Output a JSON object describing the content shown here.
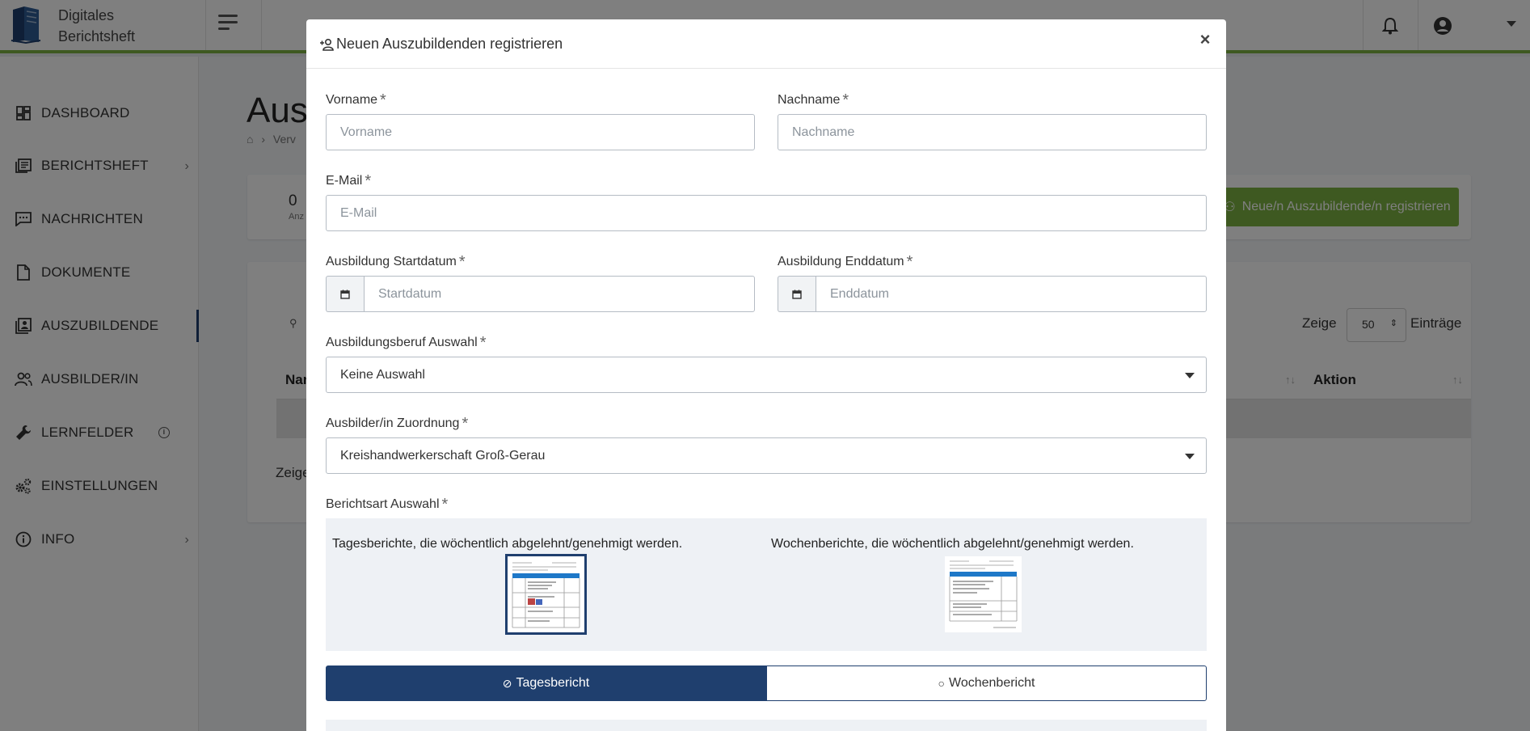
{
  "app": {
    "title_line1": "Digitales",
    "title_line2": "Berichtsheft"
  },
  "sidebar": {
    "items": [
      {
        "label": "DASHBOARD",
        "icon": "dashboard-icon"
      },
      {
        "label": "BERICHTSHEFT",
        "icon": "book-icon",
        "chevron": "›"
      },
      {
        "label": "NACHRICHTEN",
        "icon": "message-icon"
      },
      {
        "label": "DOKUMENTE",
        "icon": "document-icon"
      },
      {
        "label": "AUSZUBILDENDE",
        "icon": "trainees-icon",
        "active": true
      },
      {
        "label": "AUSBILDER/IN",
        "icon": "trainers-icon"
      },
      {
        "label": "LERNFELDER",
        "icon": "wrench-icon",
        "info": "i"
      },
      {
        "label": "EINSTELLUNGEN",
        "icon": "cogs-icon"
      },
      {
        "label": "INFO",
        "icon": "info-icon",
        "chevron": "›"
      }
    ]
  },
  "background": {
    "page_title": "Ausz",
    "breadcrumb": "Verv",
    "stat_value": "0",
    "stat_label": "Anz",
    "register_button": "Neue/n Auszubildende/n registrieren",
    "show_label": "Zeige",
    "show_value": "50",
    "entries_label": "Einträge",
    "col_name": "Nar",
    "col_action": "Aktion",
    "footer_show": "Zeige"
  },
  "modal": {
    "title": "Neuen Auszubildenden registrieren",
    "close": "×",
    "required_mark": "*",
    "fields": {
      "vorname": {
        "label": "Vorname",
        "placeholder": "Vorname",
        "value": ""
      },
      "nachname": {
        "label": "Nachname",
        "placeholder": "Nachname",
        "value": ""
      },
      "email": {
        "label": "E-Mail",
        "placeholder": "E-Mail",
        "value": ""
      },
      "start": {
        "label": "Ausbildung Startdatum",
        "placeholder": "Startdatum",
        "value": ""
      },
      "end": {
        "label": "Ausbildung Enddatum",
        "placeholder": "Enddatum",
        "value": ""
      },
      "beruf": {
        "label": "Ausbildungsberuf Auswahl",
        "value": "Keine Auswahl"
      },
      "ausbilder": {
        "label": "Ausbilder/in Zuordnung",
        "value": "Kreishandwerkerschaft Groß-Gerau"
      },
      "berichtsart": {
        "label": "Berichtsart Auswahl"
      }
    },
    "berichtsart_options": [
      {
        "text": "Tagesberichte, die wöchentlich abgelehnt/genehmigt werden.",
        "selected": true
      },
      {
        "text": "Wochenberichte, die wöchentlich abgelehnt/genehmigt werden.",
        "selected": false
      }
    ],
    "segments": {
      "active_label": "Tagesbericht",
      "active_symbol": "⊘",
      "inactive_label": "Wochenbericht",
      "inactive_symbol": "○"
    }
  },
  "colors": {
    "accent_green": "#7cb342",
    "primary_navy": "#1f3f6e"
  }
}
